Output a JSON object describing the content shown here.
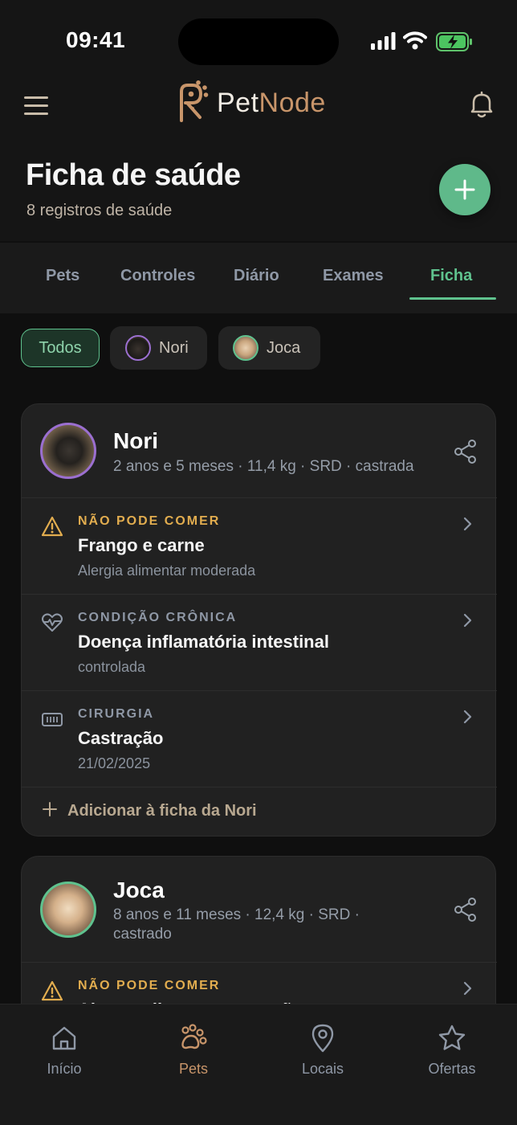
{
  "status_bar": {
    "time": "09:41"
  },
  "app": {
    "name_a": "Pet",
    "name_b": "Node"
  },
  "page": {
    "title": "Ficha de saúde",
    "subtitle": "8 registros de saúde"
  },
  "tabs": [
    {
      "label": "Pets"
    },
    {
      "label": "Controles"
    },
    {
      "label": "Diário"
    },
    {
      "label": "Exames"
    },
    {
      "label": "Ficha",
      "active": true
    }
  ],
  "filters": [
    {
      "label": "Todos",
      "active": true
    },
    {
      "label": "Nori"
    },
    {
      "label": "Joca"
    }
  ],
  "pets": [
    {
      "name": "Nori",
      "meta": "2 anos e 5 meses · 11,4 kg · SRD · castrada",
      "ring_color": "#9b6fd0",
      "records": [
        {
          "category": "NÃO PODE COMER",
          "title": "Frango e carne",
          "detail": "Alergia alimentar moderada",
          "icon": "warning-icon"
        },
        {
          "category": "CONDIÇÃO CRÔNICA",
          "title": "Doença inflamatória intestinal",
          "detail": "controlada",
          "icon": "heart-pulse-icon"
        },
        {
          "category": "CIRURGIA",
          "title": "Castração",
          "detail": "21/02/2025",
          "icon": "surgery-icon"
        }
      ],
      "add_label": "Adicionar à ficha da Nori"
    },
    {
      "name": "Joca",
      "meta_line1": "8 anos e 11 meses · 12,4 kg · SRD ·",
      "meta_line2": "castrado",
      "ring_color": "#5fc28e",
      "records": [
        {
          "category": "NÃO PODE COMER",
          "title": "Alguns alimentos para cães",
          "icon": "warning-icon"
        }
      ]
    }
  ],
  "bottom_nav": [
    {
      "label": "Início",
      "icon": "home-icon"
    },
    {
      "label": "Pets",
      "icon": "paw-icon",
      "active": true
    },
    {
      "label": "Locais",
      "icon": "location-pin-icon"
    },
    {
      "label": "Ofertas",
      "icon": "star-icon"
    }
  ],
  "colors": {
    "accent_green": "#5fc28e",
    "brand_tan": "#c8956a",
    "warning": "#e2ad4f"
  }
}
